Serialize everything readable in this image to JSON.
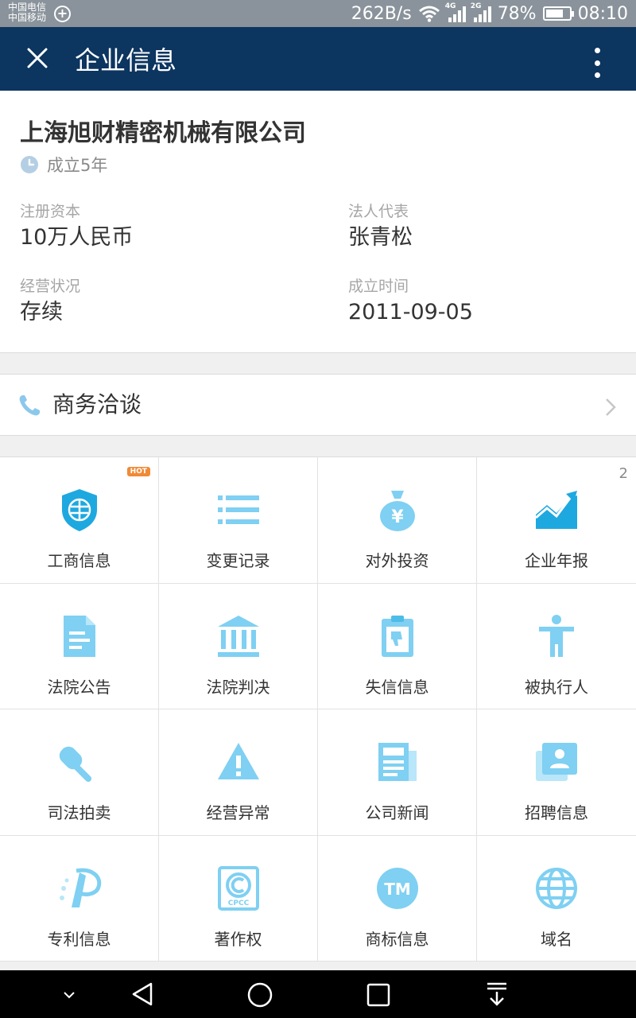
{
  "status_bar": {
    "carrier_1": "中国电信",
    "carrier_2": "中国移动",
    "speed": "262B/s",
    "net_1": "4G",
    "net_2": "2G",
    "battery": "78%",
    "battery_level": 0.78,
    "time": "08:10"
  },
  "app_bar": {
    "title": "企业信息"
  },
  "company": {
    "name": "上海旭财精密机械有限公司",
    "established_badge": "成立5年",
    "fields": [
      {
        "label": "注册资本",
        "value": "10万人民币"
      },
      {
        "label": "法人代表",
        "value": "张青松"
      },
      {
        "label": "经营状况",
        "value": "存续"
      },
      {
        "label": "成立时间",
        "value": "2011-09-05"
      }
    ]
  },
  "business_row": {
    "label": "商务洽谈"
  },
  "grid": {
    "items": [
      {
        "label": "工商信息",
        "icon": "business-shield-icon",
        "badge": "HOT"
      },
      {
        "label": "变更记录",
        "icon": "list-icon"
      },
      {
        "label": "对外投资",
        "icon": "money-bag-icon"
      },
      {
        "label": "企业年报",
        "icon": "trend-chart-icon",
        "count": "2"
      },
      {
        "label": "法院公告",
        "icon": "document-icon"
      },
      {
        "label": "法院判决",
        "icon": "courthouse-icon"
      },
      {
        "label": "失信信息",
        "icon": "clipboard-thumb-down-icon"
      },
      {
        "label": "被执行人",
        "icon": "person-icon"
      },
      {
        "label": "司法拍卖",
        "icon": "gavel-icon"
      },
      {
        "label": "经营异常",
        "icon": "warning-icon"
      },
      {
        "label": "公司新闻",
        "icon": "newspaper-icon"
      },
      {
        "label": "招聘信息",
        "icon": "contact-card-icon"
      },
      {
        "label": "专利信息",
        "icon": "patent-icon"
      },
      {
        "label": "著作权",
        "icon": "copyright-icon",
        "icon_text": "CPCC"
      },
      {
        "label": "商标信息",
        "icon": "trademark-icon",
        "icon_text": "TM"
      },
      {
        "label": "域名",
        "icon": "globe-icon"
      }
    ]
  },
  "colors": {
    "app_bar": "#0c3560",
    "icon_blue": "#7fd0f2",
    "icon_deep": "#1ea8e0"
  }
}
